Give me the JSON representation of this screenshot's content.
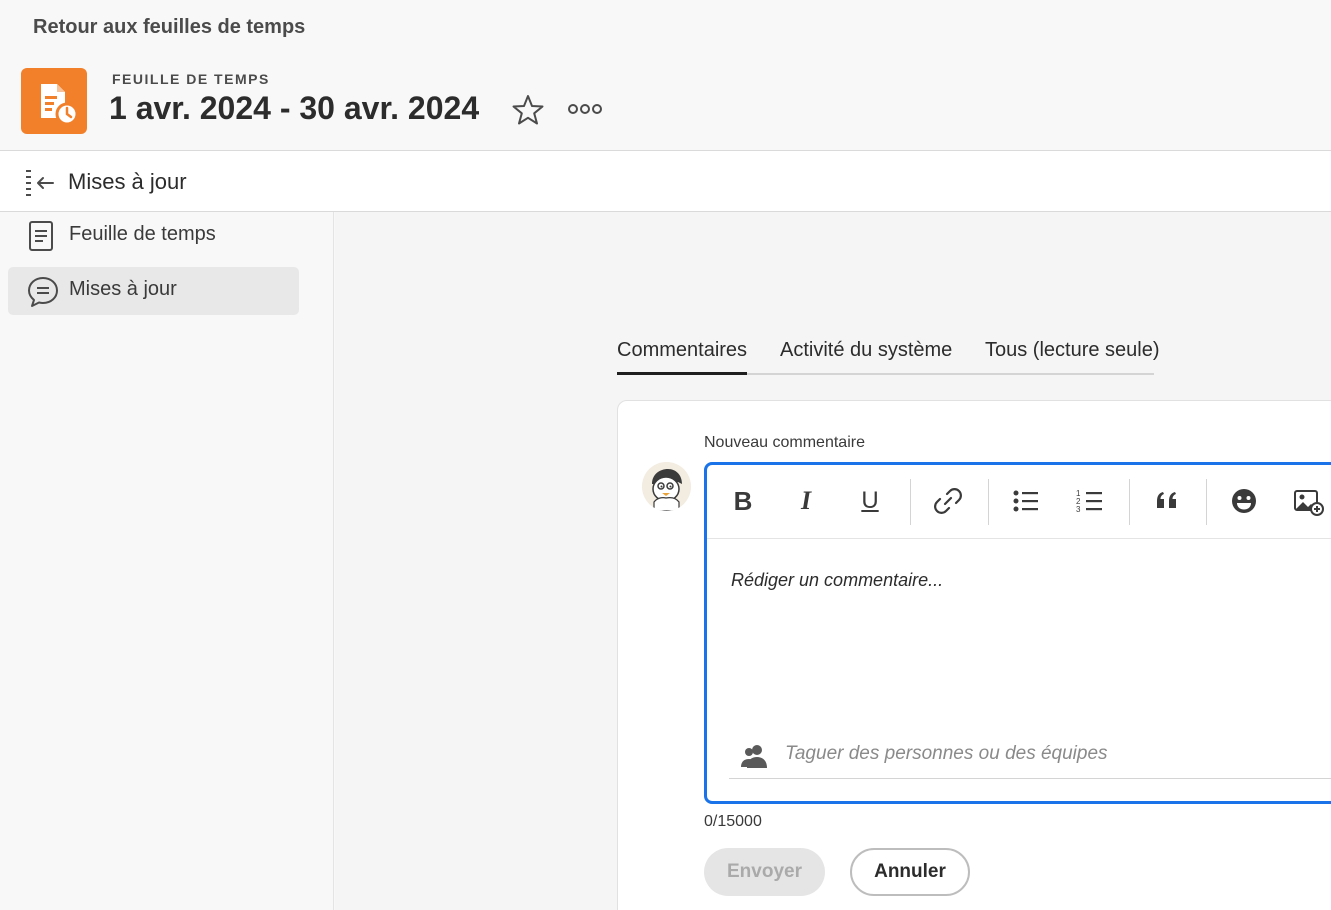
{
  "header": {
    "back_link": "Retour aux feuilles de temps",
    "eyebrow": "FEUILLE DE TEMPS",
    "title": "1 avr. 2024 - 30 avr. 2024",
    "icon": "timesheet-document-clock-icon",
    "accent_color": "#f2802a"
  },
  "updates_bar": {
    "title": "Mises à jour"
  },
  "sidebar": {
    "items": [
      {
        "label": "Feuille de temps",
        "icon": "document-lines-icon",
        "active": false
      },
      {
        "label": "Mises à jour",
        "icon": "speech-bubble-icon",
        "active": true
      }
    ]
  },
  "tabs": [
    {
      "label": "Commentaires",
      "active": true
    },
    {
      "label": "Activité du système",
      "active": false
    },
    {
      "label": "Tous (lecture seule)",
      "active": false
    }
  ],
  "comment": {
    "label": "Nouveau commentaire",
    "placeholder": "Rédiger un commentaire...",
    "tag_placeholder": "Taguer des personnes ou des équipes",
    "char_count": "0/15000",
    "send_label": "Envoyer",
    "cancel_label": "Annuler",
    "focus_color": "#1a73e8"
  },
  "toolbar": {
    "bold": "B",
    "italic": "I",
    "underline": "U"
  }
}
